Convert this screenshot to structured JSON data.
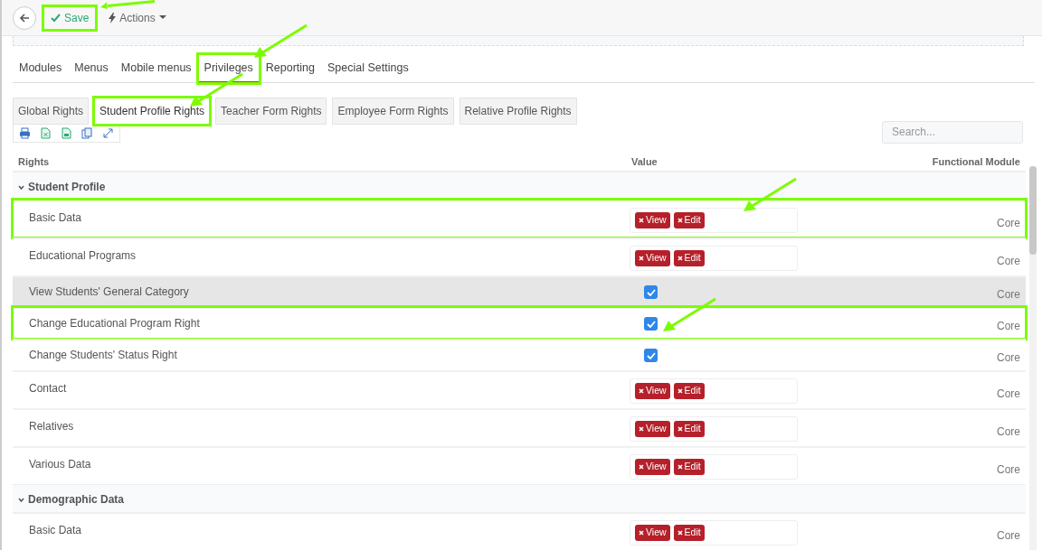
{
  "toolbar": {
    "save": {
      "label": "Save",
      "highlighted": true
    },
    "actions": {
      "label": "Actions"
    }
  },
  "tabs": [
    {
      "label": "Modules",
      "selected": false,
      "highlighted": false
    },
    {
      "label": "Menus",
      "selected": false,
      "highlighted": false
    },
    {
      "label": "Mobile menus",
      "selected": false,
      "highlighted": false
    },
    {
      "label": "Privileges",
      "selected": true,
      "highlighted": true
    },
    {
      "label": "Reporting",
      "selected": false,
      "highlighted": false
    },
    {
      "label": "Special Settings",
      "selected": false,
      "highlighted": false
    }
  ],
  "subtabs": [
    {
      "label": "Global Rights",
      "selected": false,
      "highlighted": false
    },
    {
      "label": "Student Profile Rights",
      "selected": true,
      "highlighted": true
    },
    {
      "label": "Teacher Form Rights",
      "selected": false,
      "highlighted": false
    },
    {
      "label": "Employee Form Rights",
      "selected": false,
      "highlighted": false
    },
    {
      "label": "Relative Profile Rights",
      "selected": false,
      "highlighted": false
    }
  ],
  "search": {
    "placeholder": "Search..."
  },
  "table": {
    "columns": [
      "Rights",
      "Value",
      "Functional Module"
    ],
    "groups": [
      {
        "title": "Student Profile",
        "expanded": true,
        "rows": [
          {
            "right": "Basic Data",
            "kind": "tags",
            "tags": [
              "View",
              "Edit"
            ],
            "module": "Core",
            "selected": false,
            "highlighted": true
          },
          {
            "right": "Educational Programs",
            "kind": "tags",
            "tags": [
              "View",
              "Edit"
            ],
            "module": "Core",
            "selected": false,
            "highlighted": false
          },
          {
            "right": "View Students' General Category",
            "kind": "checkbox",
            "checked": true,
            "module": "Core",
            "selected": true,
            "highlighted": false
          },
          {
            "right": "Change Educational Program Right",
            "kind": "checkbox",
            "checked": true,
            "module": "Core",
            "selected": false,
            "highlighted": true
          },
          {
            "right": "Change Students' Status Right",
            "kind": "checkbox",
            "checked": true,
            "module": "Core",
            "selected": false,
            "highlighted": false
          },
          {
            "right": "Contact",
            "kind": "tags",
            "tags": [
              "View",
              "Edit"
            ],
            "module": "Core",
            "selected": false,
            "highlighted": false
          },
          {
            "right": "Relatives",
            "kind": "tags",
            "tags": [
              "View",
              "Edit"
            ],
            "module": "Core",
            "selected": false,
            "highlighted": false
          },
          {
            "right": "Various Data",
            "kind": "tags",
            "tags": [
              "View",
              "Edit"
            ],
            "module": "Core",
            "selected": false,
            "highlighted": false
          }
        ]
      },
      {
        "title": "Demographic Data",
        "expanded": true,
        "rows": [
          {
            "right": "Basic Data",
            "kind": "tags",
            "tags": [
              "View",
              "Edit"
            ],
            "module": "Core",
            "selected": false,
            "highlighted": false
          }
        ]
      }
    ]
  }
}
